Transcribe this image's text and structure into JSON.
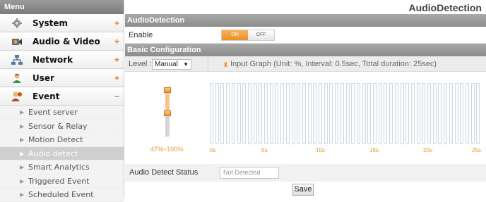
{
  "sidebar": {
    "header": "Menu",
    "items": [
      {
        "label": "System",
        "toggle": "+",
        "icon": "system-icon"
      },
      {
        "label": "Audio & Video",
        "toggle": "+",
        "icon": "audio-video-icon"
      },
      {
        "label": "Network",
        "toggle": "+",
        "icon": "network-icon"
      },
      {
        "label": "User",
        "toggle": "+",
        "icon": "user-icon"
      },
      {
        "label": "Event",
        "toggle": "−",
        "icon": "event-icon"
      }
    ],
    "event_sub": [
      "Event server",
      "Sensor & Relay",
      "Motion Detect",
      "Audio detect",
      "Smart Analytics",
      "Triggered Event",
      "Scheduled Event"
    ],
    "active_sub": "Audio detect"
  },
  "main": {
    "title": "AudioDetection",
    "section1": "AudioDetection",
    "enable_label": "Enable",
    "toggle_on": "ON",
    "toggle_off": "OFF",
    "section2": "Basic Configuration",
    "level_label": "Level :",
    "level_value": "Manual",
    "graph_info": "Input Graph (Unit: %, Interval: 0.5sec, Total duration: 25sec)",
    "slider_range": "47%~100%",
    "slider_low": 47,
    "slider_high": 100,
    "bar_count": 50,
    "ticks": [
      "0s",
      "5s",
      "10s",
      "15s",
      "20s",
      "25s"
    ],
    "status_label": "Audio Detect Status",
    "status_placeholder": "Not Detected",
    "save_label": "Save"
  },
  "colors": {
    "accent": "#ef8e23",
    "header_gray": "#8c8c8c",
    "bar_border": "#cfd9e6"
  }
}
